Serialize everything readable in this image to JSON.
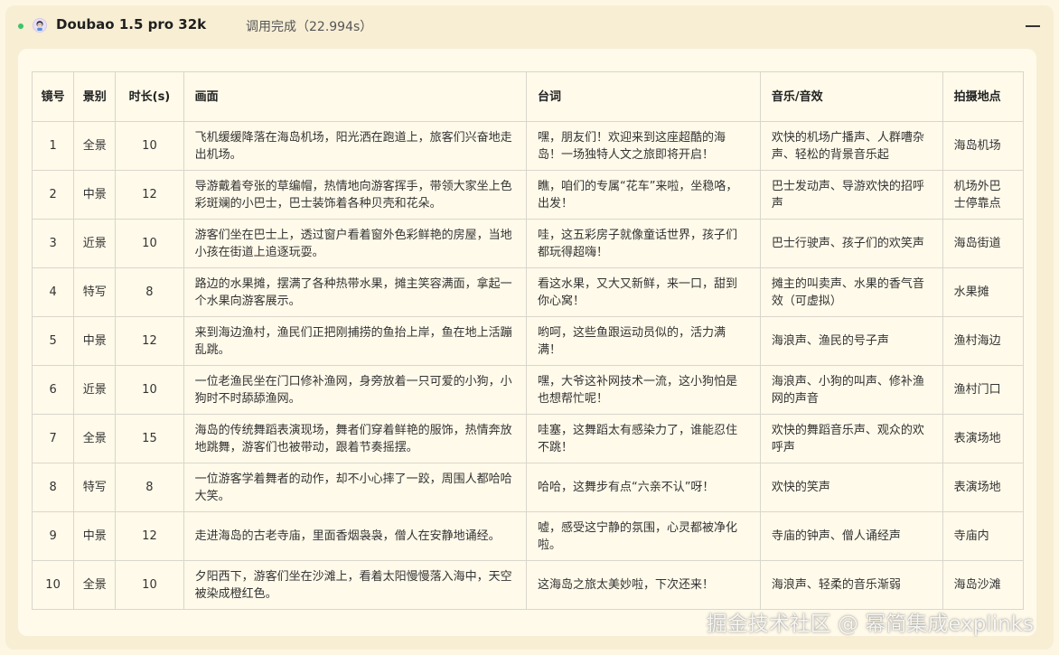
{
  "header": {
    "model_name": "Doubao 1.5 pro 32k",
    "status": "调用完成（22.994s）"
  },
  "icons": {
    "status_dot": "status-dot-icon",
    "avatar": "doubao-avatar-icon",
    "collapse": "minus-icon"
  },
  "colors": {
    "status_dot": "#3cc46a",
    "outer_bg": "#f7eed4",
    "card_bg": "#fffaea"
  },
  "table": {
    "columns": [
      "镜号",
      "景别",
      "时长(s)",
      "画面",
      "台词",
      "音乐/音效",
      "拍摄地点"
    ],
    "rows": [
      [
        "1",
        "全景",
        "10",
        "飞机缓缓降落在海岛机场，阳光洒在跑道上，旅客们兴奋地走出机场。",
        "嘿，朋友们！欢迎来到这座超酷的海岛！一场独特人文之旅即将开启！",
        "欢快的机场广播声、人群嘈杂声、轻松的背景音乐起",
        "海岛机场"
      ],
      [
        "2",
        "中景",
        "12",
        "导游戴着夸张的草编帽，热情地向游客挥手，带领大家坐上色彩斑斓的小巴士，巴士装饰着各种贝壳和花朵。",
        "瞧，咱们的专属“花车”来啦，坐稳咯，出发！",
        "巴士发动声、导游欢快的招呼声",
        "机场外巴士停靠点"
      ],
      [
        "3",
        "近景",
        "10",
        "游客们坐在巴士上，透过窗户看着窗外色彩鲜艳的房屋，当地小孩在街道上追逐玩耍。",
        "哇，这五彩房子就像童话世界，孩子们都玩得超嗨！",
        "巴士行驶声、孩子们的欢笑声",
        "海岛街道"
      ],
      [
        "4",
        "特写",
        "8",
        "路边的水果摊，摆满了各种热带水果，摊主笑容满面，拿起一个水果向游客展示。",
        "看这水果，又大又新鲜，来一口，甜到你心窝！",
        "摊主的叫卖声、水果的香气音效（可虚拟）",
        "水果摊"
      ],
      [
        "5",
        "中景",
        "12",
        "来到海边渔村，渔民们正把刚捕捞的鱼抬上岸，鱼在地上活蹦乱跳。",
        "哟呵，这些鱼跟运动员似的，活力满满！",
        "海浪声、渔民的号子声",
        "渔村海边"
      ],
      [
        "6",
        "近景",
        "10",
        "一位老渔民坐在门口修补渔网，身旁放着一只可爱的小狗，小狗时不时舔舔渔网。",
        "嘿，大爷这补网技术一流，这小狗怕是也想帮忙呢！",
        "海浪声、小狗的叫声、修补渔网的声音",
        "渔村门口"
      ],
      [
        "7",
        "全景",
        "15",
        "海岛的传统舞蹈表演现场，舞者们穿着鲜艳的服饰，热情奔放地跳舞，游客们也被带动，跟着节奏摇摆。",
        "哇塞，这舞蹈太有感染力了，谁能忍住不跳！",
        "欢快的舞蹈音乐声、观众的欢呼声",
        "表演场地"
      ],
      [
        "8",
        "特写",
        "8",
        "一位游客学着舞者的动作，却不小心摔了一跤，周围人都哈哈大笑。",
        "哈哈，这舞步有点“六亲不认”呀！",
        "欢快的笑声",
        "表演场地"
      ],
      [
        "9",
        "中景",
        "12",
        "走进海岛的古老寺庙，里面香烟袅袅，僧人在安静地诵经。",
        "嘘，感受这宁静的氛围，心灵都被净化啦。",
        "寺庙的钟声、僧人诵经声",
        "寺庙内"
      ],
      [
        "10",
        "全景",
        "10",
        "夕阳西下，游客们坐在沙滩上，看着太阳慢慢落入海中，天空被染成橙红色。",
        "这海岛之旅太美妙啦，下次还来！",
        "海浪声、轻柔的音乐渐弱",
        "海岛沙滩"
      ]
    ]
  },
  "watermark": "掘金技术社区 @ 幂简集成explinks"
}
